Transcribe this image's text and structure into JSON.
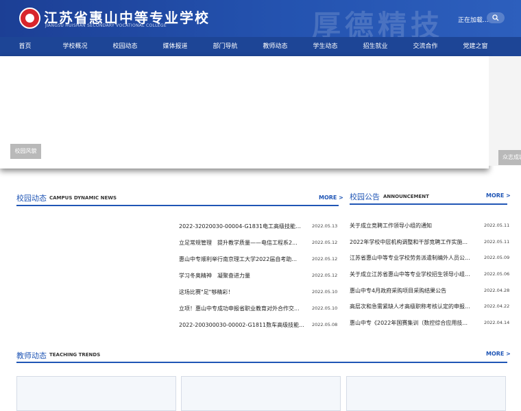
{
  "header": {
    "school_name": "江苏省惠山中等专业学校",
    "school_name_en": "JIANGSU HUISHAN SECONDARY VOCATIONAL COLLEGE",
    "motto": "厚德精技",
    "loading_text": "正在加载...",
    "search_icon": "search-icon",
    "logo_icon": "school-emblem"
  },
  "nav": {
    "items": [
      "首页",
      "学校概况",
      "校园动态",
      "媒体报道",
      "部门导航",
      "教师动态",
      "学生动态",
      "招生就业",
      "交流合作",
      "党建之窗"
    ]
  },
  "banner": {
    "label_left": "校园风貌",
    "label_right": "众志成城"
  },
  "campus_news": {
    "title": "校园动态",
    "title_en": "CAMPUS DYNAMIC NEWS",
    "more": "MORE >",
    "items": [
      {
        "title": "2022-32020030-00004-G1831电工高级技能认...",
        "date": "2022.05.13"
      },
      {
        "title": "立足常规管理　提升教学质量——电信工程系2...",
        "date": "2022.05.12"
      },
      {
        "title": "惠山中专顺利举行南京理工大学2022届自考助...",
        "date": "2022.05.12"
      },
      {
        "title": "学习冬奥精神　凝聚奋进力量",
        "date": "2022.05.12"
      },
      {
        "title": "这场比赛\"足\"够精彩！",
        "date": "2022.05.10"
      },
      {
        "title": "立项！惠山中专成功申报省职业教育对外合作交...",
        "date": "2022.05.10"
      },
      {
        "title": "2022-200300030-00002-G1811数车高级技能...",
        "date": "2022.05.08"
      }
    ]
  },
  "announcement": {
    "title": "校园公告",
    "title_en": "ANNOUNCEMENT",
    "more": "MORE >",
    "items": [
      {
        "title": "关于成立竞聘工作领导小组的通知",
        "date": "2022.05.11"
      },
      {
        "title": "2022年学校中层机构调整和干部竞聘工作实施...",
        "date": "2022.05.11"
      },
      {
        "title": "江苏省惠山中等专业学校劳务派遣制编外人员公...",
        "date": "2022.05.09"
      },
      {
        "title": "关于成立江苏省惠山中等专业学校招生领导小组...",
        "date": "2022.05.06"
      },
      {
        "title": "惠山中专4月政府采购项目采购结果公告",
        "date": "2022.04.28"
      },
      {
        "title": "高层次和急需紧缺人才高级职称考核认定的申报...",
        "date": "2022.04.22"
      },
      {
        "title": "惠山中专《2022年国赛集训（数控综合应用技...",
        "date": "2022.04.14"
      }
    ]
  },
  "teaching": {
    "title": "教师动态",
    "title_en": "TEACHING TRENDS",
    "more": "MORE >"
  }
}
